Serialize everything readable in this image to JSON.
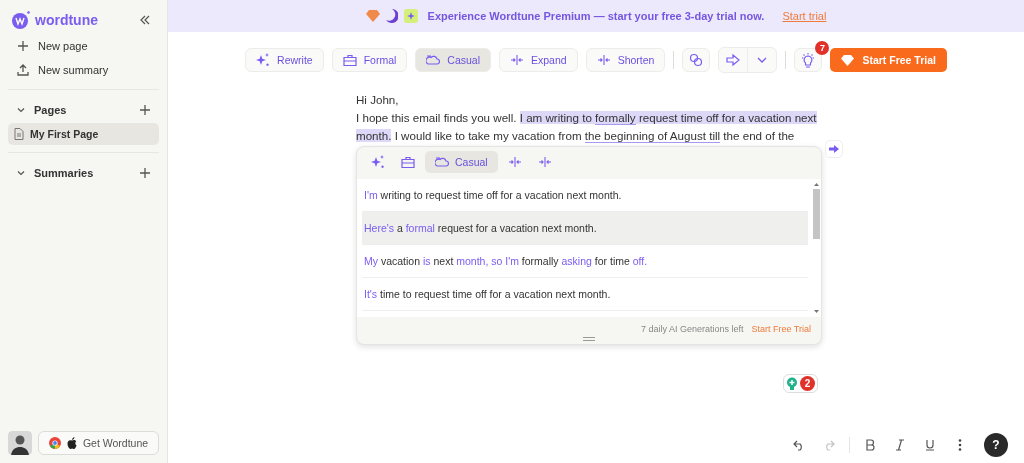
{
  "sidebar": {
    "logo": "wordtune",
    "actions": [
      {
        "label": "New page"
      },
      {
        "label": "New summary"
      }
    ],
    "sections": [
      {
        "title": "Pages",
        "expanded": true,
        "items": [
          {
            "label": "My First Page",
            "selected": true
          }
        ]
      },
      {
        "title": "Summaries",
        "expanded": true
      }
    ],
    "get_button": "Get Wordtune"
  },
  "banner": {
    "text": "Experience Wordtune Premium — start your free 3-day trial now.",
    "link": "Start trial"
  },
  "toolbar": {
    "buttons": [
      {
        "label": "Rewrite",
        "selected": false
      },
      {
        "label": "Formal",
        "selected": false
      },
      {
        "label": "Casual",
        "selected": true
      },
      {
        "label": "Expand",
        "selected": false
      },
      {
        "label": "Shorten",
        "selected": false
      }
    ],
    "tips_badge": "7",
    "trial_button": "Start Free Trial"
  },
  "editor": {
    "lines": [
      [
        {
          "text": "Hi John,",
          "kind": "plain"
        }
      ],
      [
        {
          "text": "I hope this email finds you well. ",
          "kind": "plain"
        },
        {
          "text": "I am writing to ",
          "kind": "highlight"
        },
        {
          "text": "formally",
          "kind": "highlight_underline"
        },
        {
          "text": " request time off for a vacation next month.",
          "kind": "highlight"
        },
        {
          "text": " I would like to take my vacation from ",
          "kind": "plain"
        },
        {
          "text": "the beginning of August till",
          "kind": "underline"
        },
        {
          "text": " the end of the",
          "kind": "plain"
        }
      ]
    ]
  },
  "popup": {
    "tones": [
      {
        "label": "Casual",
        "selected": true
      }
    ],
    "suggestions": [
      {
        "selected": false,
        "parts": [
          {
            "text": "I'm",
            "changed": true
          },
          {
            "text": " writing to request time off for a vacation next month.",
            "changed": false
          }
        ]
      },
      {
        "selected": true,
        "parts": [
          {
            "text": "Here's",
            "changed": true
          },
          {
            "text": " a ",
            "changed": false
          },
          {
            "text": "formal",
            "changed": true
          },
          {
            "text": " request for a vacation next month.",
            "changed": false
          }
        ]
      },
      {
        "selected": false,
        "parts": [
          {
            "text": "My",
            "changed": true
          },
          {
            "text": " vacation ",
            "changed": false
          },
          {
            "text": "is",
            "changed": true
          },
          {
            "text": " next ",
            "changed": false
          },
          {
            "text": "month, so I'm",
            "changed": true
          },
          {
            "text": " formally ",
            "changed": false
          },
          {
            "text": "asking",
            "changed": true
          },
          {
            "text": " for time ",
            "changed": false
          },
          {
            "text": "off.",
            "changed": true
          }
        ]
      },
      {
        "selected": false,
        "parts": [
          {
            "text": "It's",
            "changed": true
          },
          {
            "text": " time to request time off for a vacation next month.",
            "changed": false
          }
        ]
      }
    ],
    "footer_text": "7 daily AI Generations left",
    "footer_link": "Start Free Trial"
  },
  "grammar_badge": "2",
  "format_bar": {
    "tools": [
      {
        "disabled": false
      },
      {
        "disabled": true
      },
      {
        "disabled": false
      },
      {
        "disabled": false
      },
      {
        "disabled": false
      },
      {
        "disabled": false
      }
    ],
    "help": "?"
  }
}
